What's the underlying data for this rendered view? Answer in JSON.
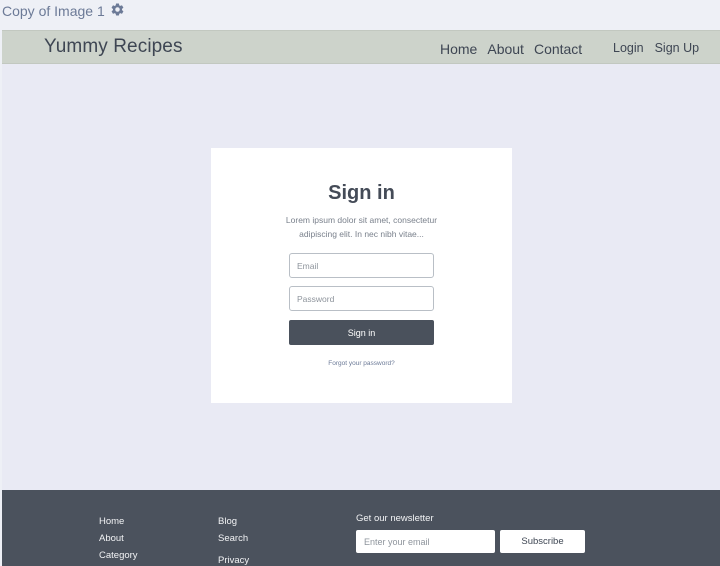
{
  "copy_label": {
    "text": "Copy of Image 1",
    "icon": "gear-icon"
  },
  "header": {
    "brand": "Yummy Recipes",
    "nav": [
      "Home",
      "About",
      "Contact"
    ],
    "auth": [
      "Login",
      "Sign Up"
    ]
  },
  "signin": {
    "title": "Sign in",
    "description": "Lorem ipsum dolor sit amet, consectetur adipiscing elit. In nec nibh vitae...",
    "email_placeholder": "Email",
    "password_placeholder": "Password",
    "button": "Sign in",
    "forgot": "Forgot your password?"
  },
  "footer": {
    "col1": [
      "Home",
      "About",
      "Category"
    ],
    "col2": [
      "Blog",
      "Search",
      "Privacy"
    ],
    "newsletter_title": "Get our newsletter",
    "email_placeholder": "Enter your email",
    "subscribe": "Subscribe"
  },
  "colors": {
    "navbar": "#cdd3cb",
    "footer": "#4b525d",
    "button": "#4a515c",
    "content_bg": "#e9eaf4"
  }
}
